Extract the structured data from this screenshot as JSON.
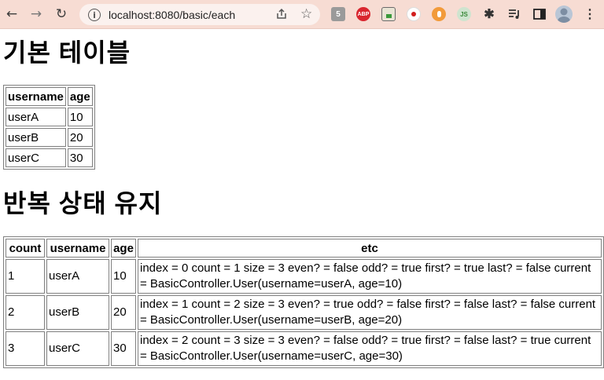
{
  "browser": {
    "url": "localhost:8080/basic/each",
    "back_icon": "←",
    "forward_icon": "→",
    "reload_icon": "↻"
  },
  "page": {
    "heading1": "기본 테이블",
    "heading2": "반복 상태 유지",
    "table1": {
      "headers": [
        "username",
        "age"
      ],
      "rows": [
        [
          "userA",
          "10"
        ],
        [
          "userB",
          "20"
        ],
        [
          "userC",
          "30"
        ]
      ]
    },
    "table2": {
      "headers": [
        "count",
        "username",
        "age",
        "etc"
      ],
      "rows": [
        [
          "1",
          "userA",
          "10",
          "index = 0 count = 1 size = 3 even? = false odd? = true first? = true last? = false current = BasicController.User(username=userA, age=10)"
        ],
        [
          "2",
          "userB",
          "20",
          "index = 1 count = 2 size = 3 even? = true odd? = false first? = false last? = false current = BasicController.User(username=userB, age=20)"
        ],
        [
          "3",
          "userC",
          "30",
          "index = 2 count = 3 size = 3 even? = false odd? = true first? = false last? = true current = BasicController.User(username=userC, age=30)"
        ]
      ]
    }
  }
}
